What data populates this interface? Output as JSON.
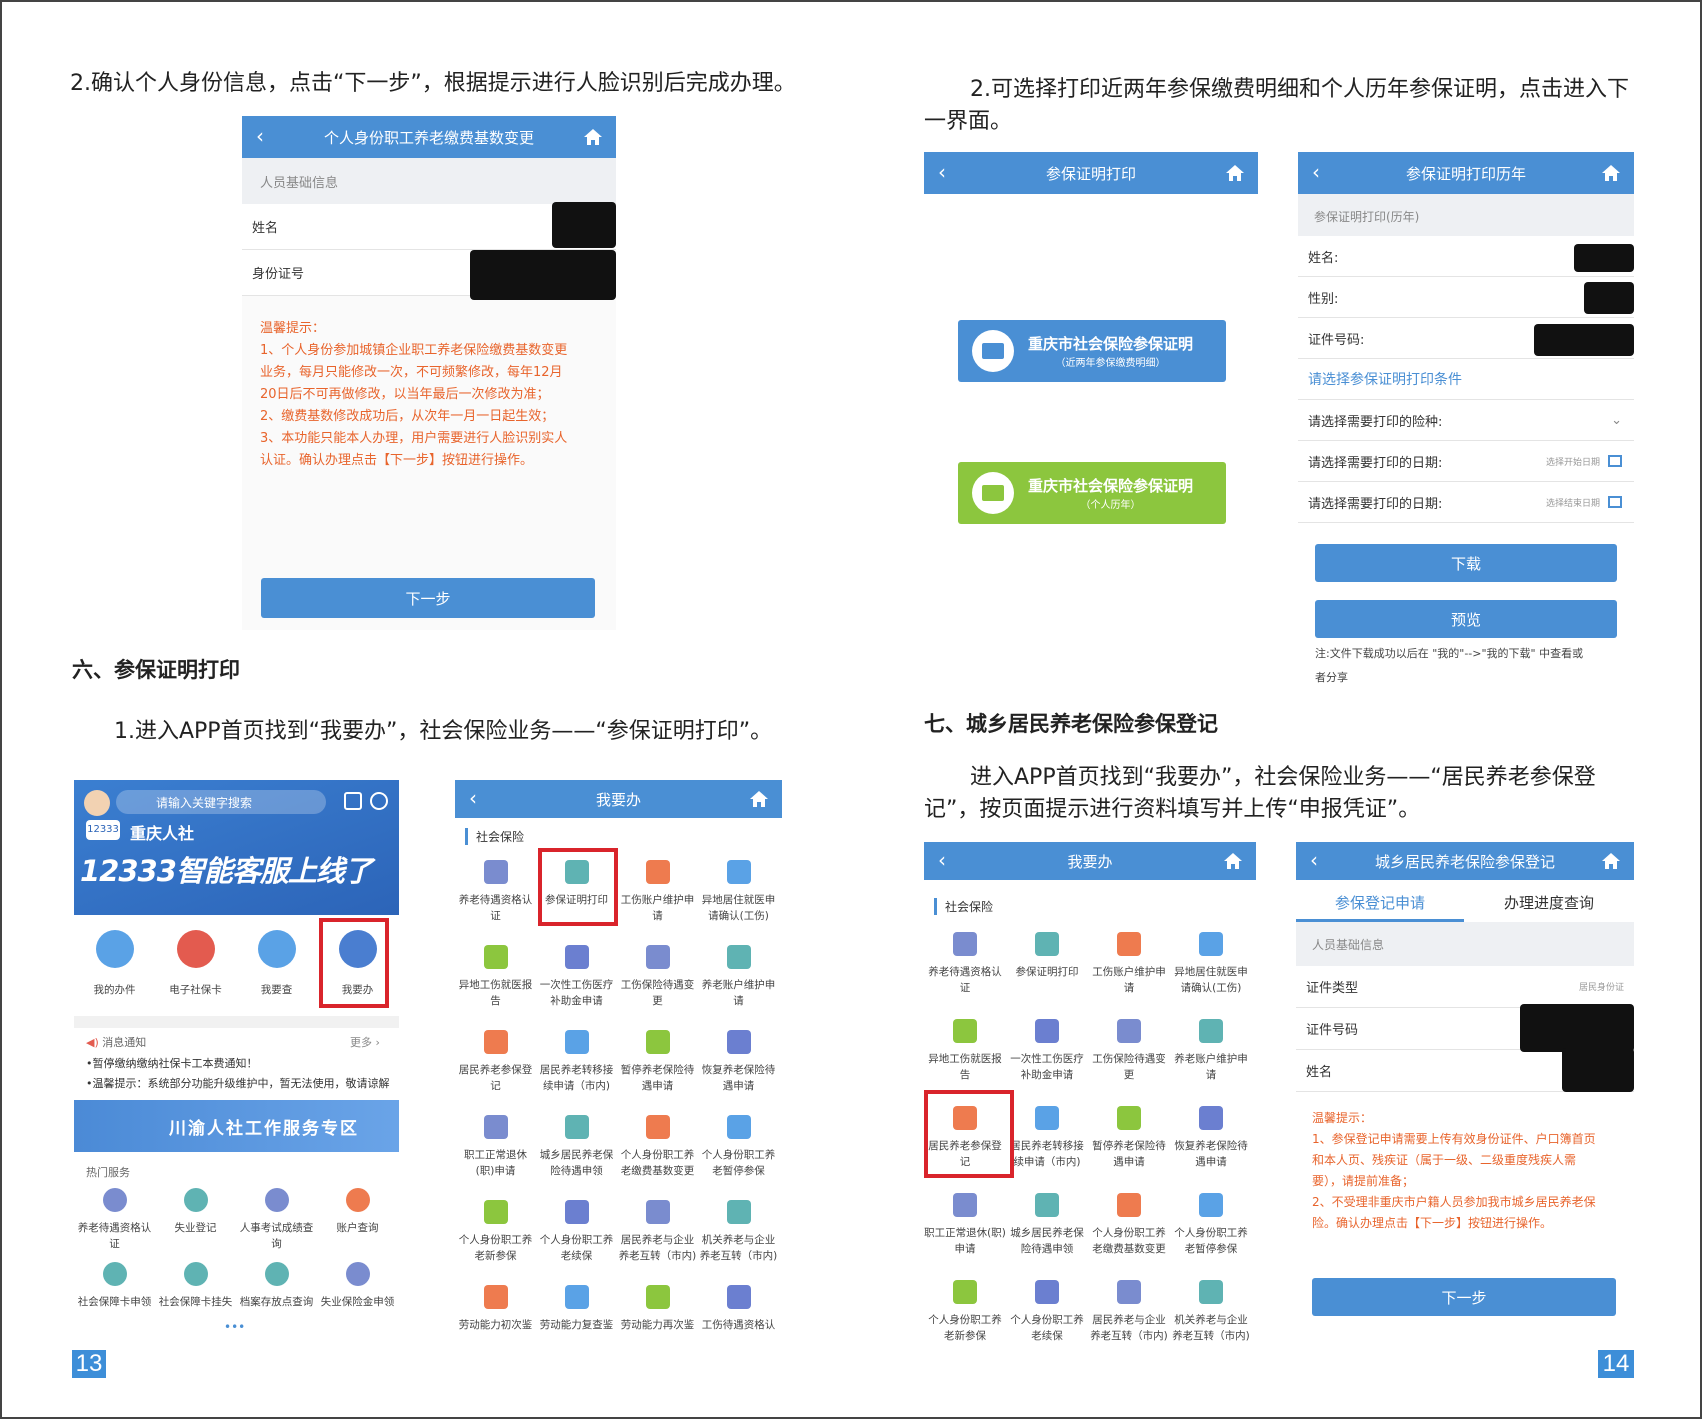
{
  "left": {
    "step2": "2.确认个人身份信息，点击“下一步”，根据提示进行人脸识别后完成办理。",
    "phone1": {
      "title": "个人身份职工养老缴费基数变更",
      "section": "人员基础信息",
      "name_label": "姓名",
      "id_label": "身份证号",
      "tips": [
        "温馨提示：",
        "1、个人身份参加城镇企业职工养老保险缴费基数变更",
        "业务，每月只能修改一次，不可频繁修改，每年12月",
        "20日后不可再做修改，以当年最后一次修改为准；",
        "2、缴费基数修改成功后，从次年一月一日起生效；",
        "3、本功能只能本人办理，用户需要进行人脸识别实人",
        "认证。确认办理点击【下一步】按钮进行操作。"
      ],
      "next": "下一步"
    },
    "section6": "六、参保证明打印",
    "step1": "1.进入APP首页找到“我要办”，社会保险业务——“参保证明打印”。",
    "home": {
      "search": "请输入关键字搜索",
      "brand": "重庆人社",
      "banner": "12333智能客服上线了",
      "icons": [
        "我的办件",
        "电子社保卡",
        "我要查",
        "我要办"
      ],
      "notice_label": "消息通知",
      "more": "更多 ›",
      "notices": [
        "•暂停缴纳缴纳社保卡工本费通知！",
        "•温馨提示：系统部分功能升级维护中，暂无法使用，敬请谅解"
      ],
      "zone": "川渝人社工作服务专区",
      "hot": "热门服务",
      "hot_items": [
        "养老待遇资格认证",
        "失业登记",
        "人事考试成绩查询",
        "账户查询",
        "社会保障卡申领",
        "社会保障卡挂失",
        "档案存放点查询",
        "失业保险金申领"
      ],
      "dots": "•••"
    },
    "woyao1": {
      "title": "我要办",
      "section": "社会保险",
      "items": [
        "养老待遇资格认证",
        "参保证明打印",
        "工伤账户维护申请",
        "异地居住就医申请确认(工伤)",
        "异地工伤就医报告",
        "一次性工伤医疗补助金申请",
        "工伤保险待遇变更",
        "养老账户维护申请",
        "居民养老参保登记",
        "居民养老转移接续申请（市内)",
        "暂停养老保险待遇申请",
        "恢复养老保险待遇申请",
        "职工正常退休(职)申请",
        "城乡居民养老保险待遇申领",
        "个人身份职工养老缴费基数变更",
        "个人身份职工养老暂停参保",
        "个人身份职工养老新参保",
        "个人身份职工养老续保",
        "居民养老与企业养老互转（市内)",
        "机关养老与企业养老互转（市内)",
        "劳动能力初次鉴",
        "劳动能力复查鉴",
        "劳动能力再次鉴",
        "工伤待遇资格认"
      ]
    },
    "page": "13"
  },
  "right": {
    "step2": "2.可选择打印近两年参保缴费明细和个人历年参保证明，点击进入下一界面。",
    "phone_a": {
      "title": "参保证明打印",
      "btn1": {
        "title": "重庆市社会保险参保证明",
        "sub": "（近两年参保缴费明细）"
      },
      "btn2": {
        "title": "重庆市社会保险参保证明",
        "sub": "（个人历年）"
      }
    },
    "phone_b": {
      "title": "参保证明打印历年",
      "section": "参保证明打印(历年)",
      "name": "姓名:",
      "sex": "性别:",
      "cert": "证件号码:",
      "cond": "请选择参保证明打印条件",
      "type": "请选择需要打印的险种:",
      "date1": "请选择需要打印的日期:",
      "date1_ph": "选择开始日期",
      "date2": "请选择需要打印的日期:",
      "date2_ph": "选择结束日期",
      "download": "下载",
      "preview": "预览",
      "note": [
        "注:文件下载成功以后在 \"我的\"-->\"我的下载\" 中查看或",
        "者分享"
      ]
    },
    "section7": "七、城乡居民养老保险参保登记",
    "step": "进入APP首页找到“我要办”，社会保险业务——“居民养老参保登记”，按页面提示进行资料填写并上传“申报凭证”。",
    "woyao2": {
      "title": "我要办",
      "section": "社会保险",
      "items": [
        "养老待遇资格认证",
        "参保证明打印",
        "工伤账户维护申请",
        "异地居住就医申请确认(工伤)",
        "异地工伤就医报告",
        "一次性工伤医疗补助金申请",
        "工伤保险待遇变更",
        "养老账户维护申请",
        "居民养老参保登记",
        "居民养老转移接续申请（市内)",
        "暂停养老保险待遇申请",
        "恢复养老保险待遇申请",
        "职工正常退休(职)申请",
        "城乡居民养老保险待遇申领",
        "个人身份职工养老缴费基数变更",
        "个人身份职工养老暂停参保",
        "个人身份职工养老新参保",
        "个人身份职工养老续保",
        "居民养老与企业养老互转（市内)",
        "机关养老与企业养老互转（市内)"
      ]
    },
    "phone_c": {
      "title": "城乡居民养老保险参保登记",
      "tab1": "参保登记申请",
      "tab2": "办理进度查询",
      "section": "人员基础信息",
      "cert_type": "证件类型",
      "cert_type_val": "居民身份证",
      "cert_no": "证件号码",
      "name": "姓名",
      "tips": [
        "温馨提示：",
        "1、参保登记申请需要上传有效身份证件、户口簿首页",
        "和本人页、残疾证（属于一级、二级重度残疾人需",
        "要），请提前准备；",
        "2、不受理非重庆市户籍人员参加我市城乡居民养老保",
        "险。确认办理点击【下一步】按钮进行操作。"
      ],
      "next": "下一步"
    },
    "page": "14"
  },
  "colors": {
    "blue": "#4a8fd4",
    "red": "#d9242b",
    "orange": "#e8642c",
    "green": "#8cc63e"
  }
}
